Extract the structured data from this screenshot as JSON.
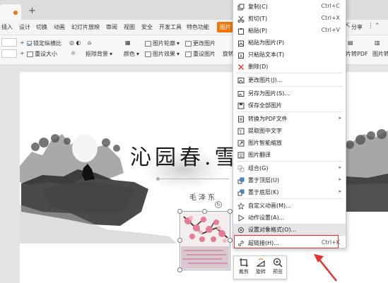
{
  "tabs": {
    "plus": "+"
  },
  "menu": {
    "items": [
      "插入",
      "设计",
      "切换",
      "动画",
      "幻灯片放映",
      "审阅",
      "视图",
      "安全",
      "开发工具",
      "特色功能",
      "图片"
    ],
    "share": "分享"
  },
  "toolbar": {
    "lock_ratio": "锁定纵横比",
    "reset_size": "重设大小",
    "remove_bg": "抠除背景",
    "color": "颜色",
    "outline": "图片轮廓",
    "effect": "图片效果",
    "change_pic": "更改图片",
    "reset_pic": "重设图片",
    "rotate": "旋转",
    "to_pdf": "片转PDF",
    "pic_trans": "图片转"
  },
  "slide": {
    "title": "沁园春.雪",
    "author": "毛泽东"
  },
  "mini_toolbar": {
    "crop": "裁剪",
    "rotate": "旋转",
    "preview": "预览"
  },
  "context_menu": {
    "items": [
      {
        "label": "复制(C)",
        "shortcut": "Ctrl+C",
        "icon": "copy-icon"
      },
      {
        "label": "剪切(T)",
        "shortcut": "Ctrl+X",
        "icon": "scissors-icon"
      },
      {
        "label": "粘贴(P)",
        "shortcut": "Ctrl+V",
        "icon": "paste-icon"
      },
      {
        "label": "粘贴为图片(P)",
        "shortcut": "",
        "icon": "paste-image-icon"
      },
      {
        "label": "只粘贴文本(T)",
        "shortcut": "",
        "icon": "paste-text-icon"
      },
      {
        "label": "删除(D)",
        "shortcut": "",
        "icon": "delete-icon"
      },
      {
        "label": "更改图片(J)...",
        "shortcut": "",
        "icon": "change-image-icon"
      },
      {
        "label": "另存为图片(S)...",
        "shortcut": "",
        "icon": "save-image-icon"
      },
      {
        "label": "保存全部图片",
        "shortcut": "",
        "icon": "save-all-images-icon"
      },
      {
        "label": "转换为PDF文件",
        "shortcut": "",
        "icon": "pdf-icon"
      },
      {
        "label": "提取图中文字",
        "shortcut": "",
        "icon": "ocr-icon"
      },
      {
        "label": "图片智能缩放",
        "shortcut": "",
        "icon": "smart-scale-icon"
      },
      {
        "label": "图片翻译",
        "shortcut": "",
        "icon": "translate-icon"
      },
      {
        "label": "组合(G)",
        "shortcut": "",
        "icon": "group-icon"
      },
      {
        "label": "置于顶层(U)",
        "shortcut": "",
        "icon": "bring-front-icon"
      },
      {
        "label": "置于底层(K)",
        "shortcut": "",
        "icon": "send-back-icon"
      },
      {
        "label": "自定义动画(M)...",
        "shortcut": "",
        "icon": "animation-icon"
      },
      {
        "label": "动作设置(A)...",
        "shortcut": "",
        "icon": "action-icon"
      },
      {
        "label": "设置对象格式(O)...",
        "shortcut": "",
        "icon": "format-object-icon"
      },
      {
        "label": "超链接(H)...",
        "shortcut": "Ctrl+K",
        "icon": "hyperlink-icon"
      }
    ]
  },
  "colors": {
    "accent": "#f0750a",
    "highlight": "#e8332d"
  }
}
